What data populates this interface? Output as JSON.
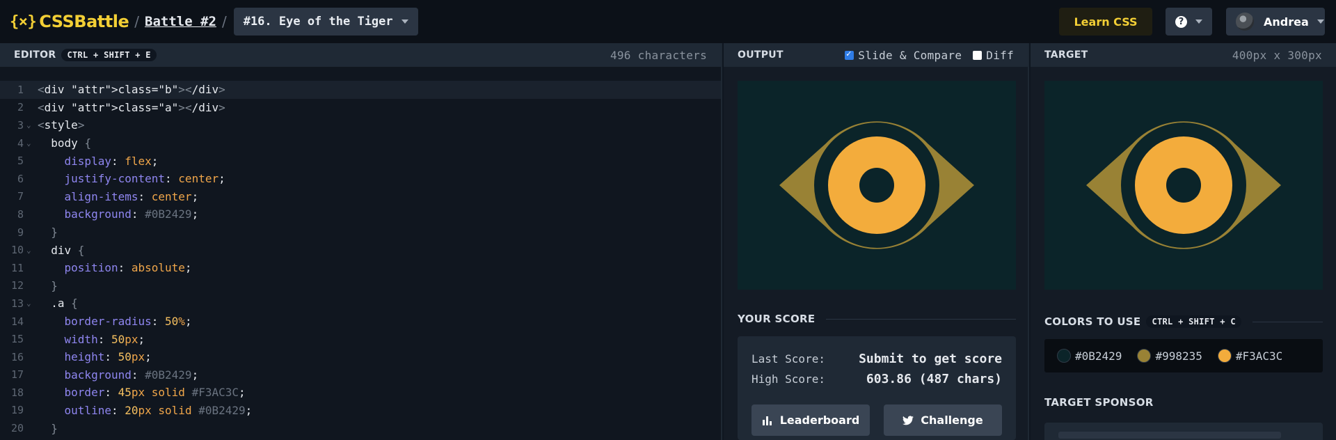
{
  "header": {
    "logo_text": "CSSBattle",
    "breadcrumb_battle": "Battle #2",
    "challenge_select": "#16. Eye of the Tiger",
    "learn_button": "Learn CSS",
    "help_icon": "question-circle-icon",
    "user_name": "Andrea"
  },
  "editor": {
    "title": "EDITOR",
    "shortcut": "CTRL + SHIFT + E",
    "char_count": "496 characters",
    "lines": [
      "<div class=\"b\"></div>",
      "<div class=\"a\"></div>",
      "<style>",
      "  body {",
      "    display: flex;",
      "    justify-content: center;",
      "    align-items: center;",
      "    background: #0B2429;",
      "  }",
      "  div {",
      "    position: absolute;",
      "  }",
      "  .a {",
      "    border-radius: 50%;",
      "    width: 50px;",
      "    height: 50px;",
      "    background: #0B2429;",
      "    border: 45px solid #F3AC3C;",
      "    outline: 20px solid #0B2429;",
      "  }"
    ]
  },
  "output": {
    "title": "OUTPUT",
    "slide_compare_label": "Slide & Compare",
    "slide_compare_checked": true,
    "diff_label": "Diff",
    "diff_checked": false
  },
  "score": {
    "title": "YOUR SCORE",
    "last_label": "Last Score:",
    "last_value": "Submit to get score",
    "high_label": "High Score:",
    "high_value": "603.86 (487 chars)",
    "leaderboard_button": "Leaderboard",
    "challenge_button": "Challenge"
  },
  "target": {
    "title": "TARGET",
    "size": "400px x 300px",
    "colors_title": "COLORS TO USE",
    "colors_shortcut": "CTRL + SHIFT + C",
    "colors": [
      "#0B2429",
      "#998235",
      "#F3AC3C"
    ],
    "sponsor_title": "TARGET SPONSOR"
  }
}
